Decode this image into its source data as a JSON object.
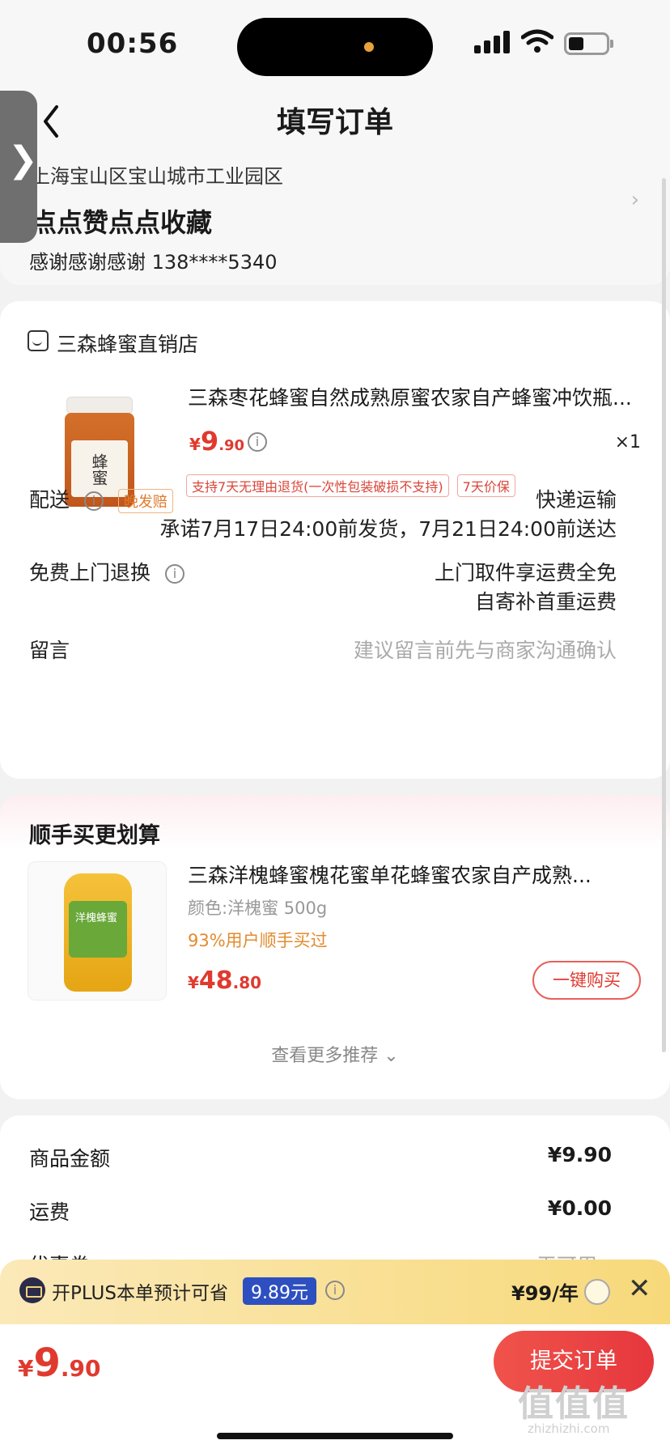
{
  "status_bar": {
    "time": "00:56"
  },
  "nav": {
    "title": "填写订单",
    "back_icon": "chevron-left-icon"
  },
  "side_tab": {
    "glyph": "❯"
  },
  "address": {
    "line": "上海宝山区宝山城市工业园区",
    "name": "点点赞点点收藏",
    "contact": "感谢感谢感谢   138****5340",
    "arrow": "›"
  },
  "order": {
    "shop_name": "三森蜂蜜直销店",
    "product": {
      "title": "三森枣花蜂蜜自然成熟原蜜农家自产蜂蜜冲饮瓶...",
      "image_label": "蜂蜜",
      "price_currency": "¥",
      "price_int": "9",
      "price_dec": ".90",
      "quantity": "×1",
      "tags": [
        "支持7天无理由退货(一次性包装破损不支持)",
        "7天价保"
      ]
    },
    "delivery": {
      "label": "配送",
      "badge": "晚发赔",
      "method": "快递运输",
      "promise": "承诺7月17日24:00前发货，7月21日24:00前送达"
    },
    "return": {
      "label": "免费上门退换",
      "line1": "上门取件享运费全免",
      "line2": "自寄补首重运费"
    },
    "message": {
      "label": "留言",
      "placeholder": "建议留言前先与商家沟通确认"
    }
  },
  "recommend": {
    "title": "顺手买更划算",
    "item": {
      "name": "三森洋槐蜂蜜槐花蜜单花蜂蜜农家自产成熟...",
      "image_label": "洋槐蜂蜜",
      "spec": "颜色:洋槐蜜 500g",
      "bought": "93%用户顺手买过",
      "price_currency": "¥",
      "price_int": "48",
      "price_dec": ".80",
      "buy_label": "一键购买"
    },
    "more_label": "查看更多推荐 ⌄"
  },
  "summary": {
    "rows": [
      {
        "label": "商品金额",
        "value": "¥9.90"
      },
      {
        "label": "运费",
        "value": "¥0.00"
      },
      {
        "label": "优惠券",
        "value": "无可用 ›"
      }
    ]
  },
  "plus": {
    "text": "开PLUS本单预计可省",
    "save": "9.89元",
    "price": "¥99/年",
    "close": "✕"
  },
  "bottom": {
    "price_currency": "¥",
    "price_int": "9",
    "price_dec": ".90",
    "submit_label": "提交订单",
    "watermark": "值值值",
    "watermark_sub": "zhizhizhi.com"
  },
  "colors": {
    "accent_red": "#e03a2f",
    "plus_blue": "#2d4fc0",
    "plus_gold": "#f7d97a"
  }
}
